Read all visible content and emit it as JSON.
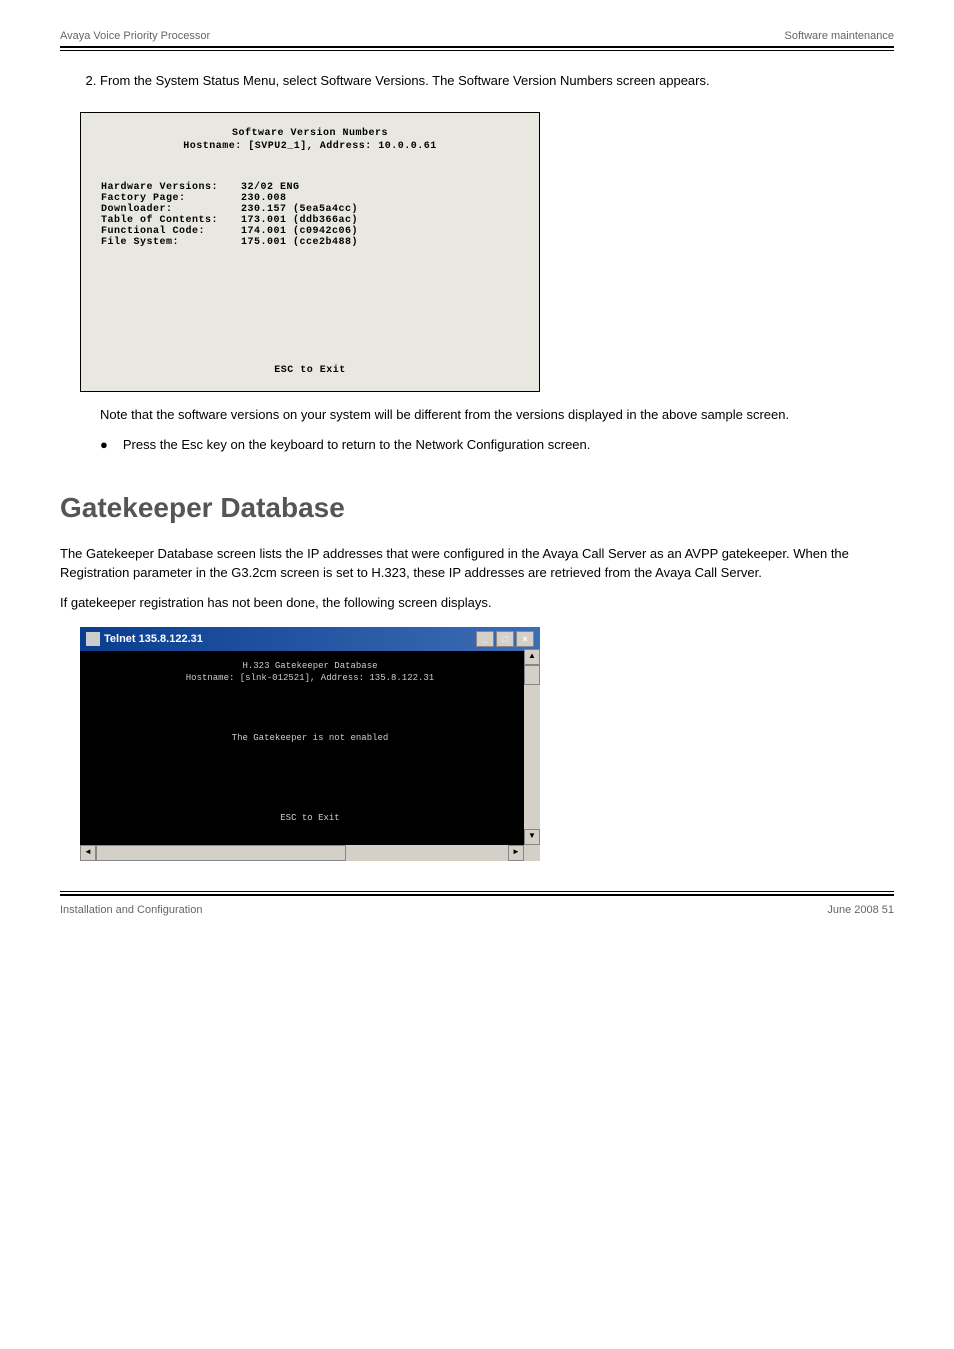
{
  "header": {
    "left": "Avaya Voice Priority Processor",
    "right": "Software maintenance"
  },
  "instructions": [
    "From the System Status Menu, select Software Versions. The Software Version Numbers screen appears."
  ],
  "terminal1": {
    "title": "Software Version Numbers",
    "subtitle": "Hostname: [SVPU2_1], Address: 10.0.0.61",
    "rows": [
      {
        "label": "Hardware Versions:",
        "value": "32/02 ENG"
      },
      {
        "label": "Factory Page:",
        "value": "230.008"
      },
      {
        "label": "Downloader:",
        "value": "230.157 (5ea5a4cc)"
      },
      {
        "label": "Table of Contents:",
        "value": "173.001 (ddb366ac)"
      },
      {
        "label": "Functional Code:",
        "value": "174.001 (c0942c06)"
      },
      {
        "label": "File System:",
        "value": "175.001 (cce2b488)"
      }
    ],
    "footer": "ESC to Exit"
  },
  "note": "Note that the software versions on your system will be different from the versions displayed in the above sample screen.",
  "bullet": "Press the Esc key on the keyboard to return to the Network Configuration screen.",
  "section_heading": "Gatekeeper Database",
  "body1": "The Gatekeeper Database screen lists the IP addresses that were configured in the Avaya Call Server as an AVPP gatekeeper. When the Registration parameter in the G3.2cm screen is set to H.323, these IP addresses are retrieved from the Avaya Call Server.",
  "body2": "If gatekeeper registration has not been done, the following screen displays.",
  "telnet": {
    "titlebar": "Telnet 135.8.122.31",
    "content_title": "H.323 Gatekeeper Database",
    "content_subtitle": "Hostname: [slnk-012521], Address: 135.8.122.31",
    "content_msg": "The Gatekeeper is not enabled",
    "content_footer": "ESC to Exit"
  },
  "footer": {
    "left": "Installation and Configuration",
    "right": "June 2008     51"
  }
}
